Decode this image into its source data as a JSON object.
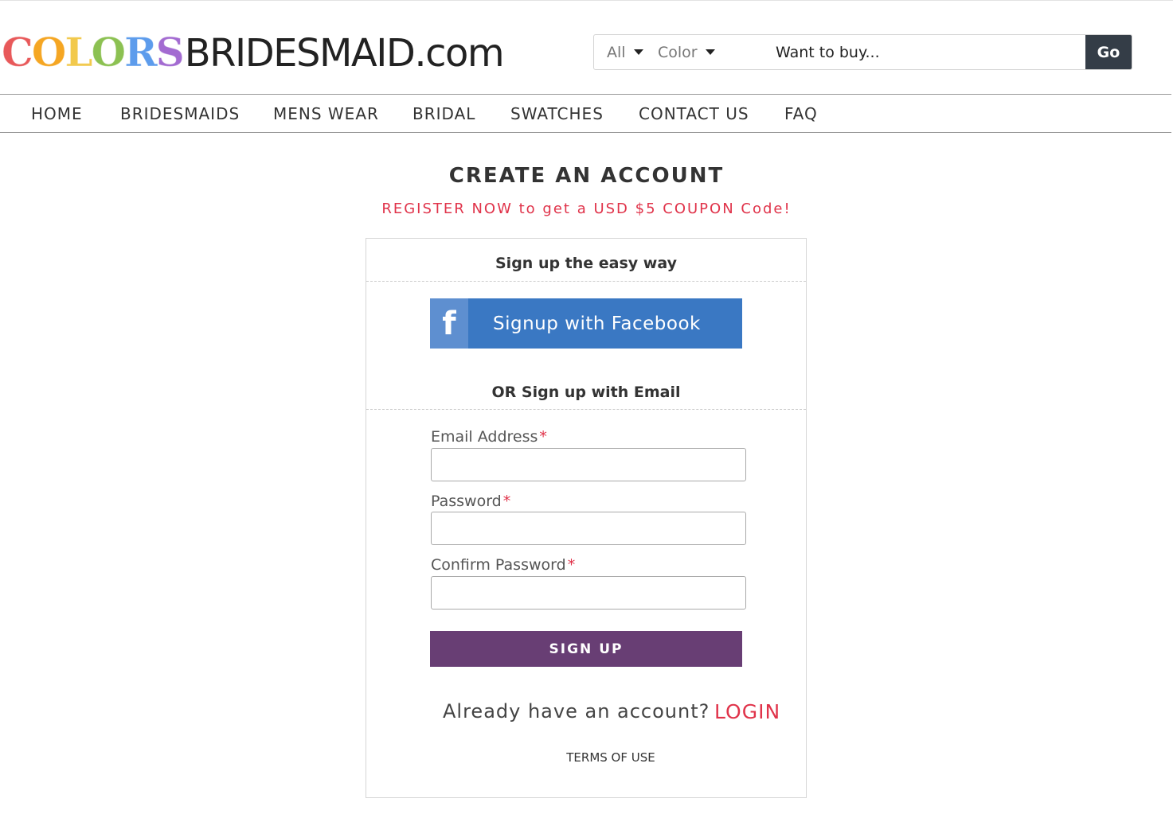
{
  "header": {
    "logo_letters": [
      {
        "char": "C",
        "color": "#e8595a"
      },
      {
        "char": "O",
        "color": "#f5a623"
      },
      {
        "char": "L",
        "color": "#f2c94c"
      },
      {
        "char": "O",
        "color": "#8cc152"
      },
      {
        "char": "R",
        "color": "#5d9cec"
      },
      {
        "char": "S",
        "color": "#a36bd1"
      }
    ],
    "logo_brand": "BRIDESMAID.com",
    "search": {
      "category_value": "All",
      "color_value": "Color",
      "placeholder": "Want to buy...",
      "go_label": "Go"
    }
  },
  "nav": {
    "items": [
      {
        "label": "HOME"
      },
      {
        "label": "BRIDESMAIDS"
      },
      {
        "label": "MENS WEAR"
      },
      {
        "label": "BRIDAL"
      },
      {
        "label": "SWATCHES"
      },
      {
        "label": "CONTACT US"
      },
      {
        "label": "FAQ"
      }
    ]
  },
  "main": {
    "title": "CREATE AN ACCOUNT",
    "promo": "REGISTER NOW to get a USD $5 COUPON Code!",
    "card": {
      "easy_heading": "Sign up the easy way",
      "facebook_icon": "f",
      "facebook_label": "Signup with Facebook",
      "email_heading": "OR Sign up with Email",
      "fields": {
        "email_label": "Email Address",
        "password_label": "Password",
        "confirm_label": "Confirm Password",
        "required_mark": "*"
      },
      "signup_label": "SIGN UP",
      "already_text": "Already have an account?",
      "login_label": "LOGIN",
      "terms_label": "TERMS OF USE"
    }
  },
  "colors": {
    "accent_red": "#e0334a",
    "signup_purple": "#683e74",
    "facebook_blue": "#3a78c3",
    "go_dark": "#343d47"
  }
}
